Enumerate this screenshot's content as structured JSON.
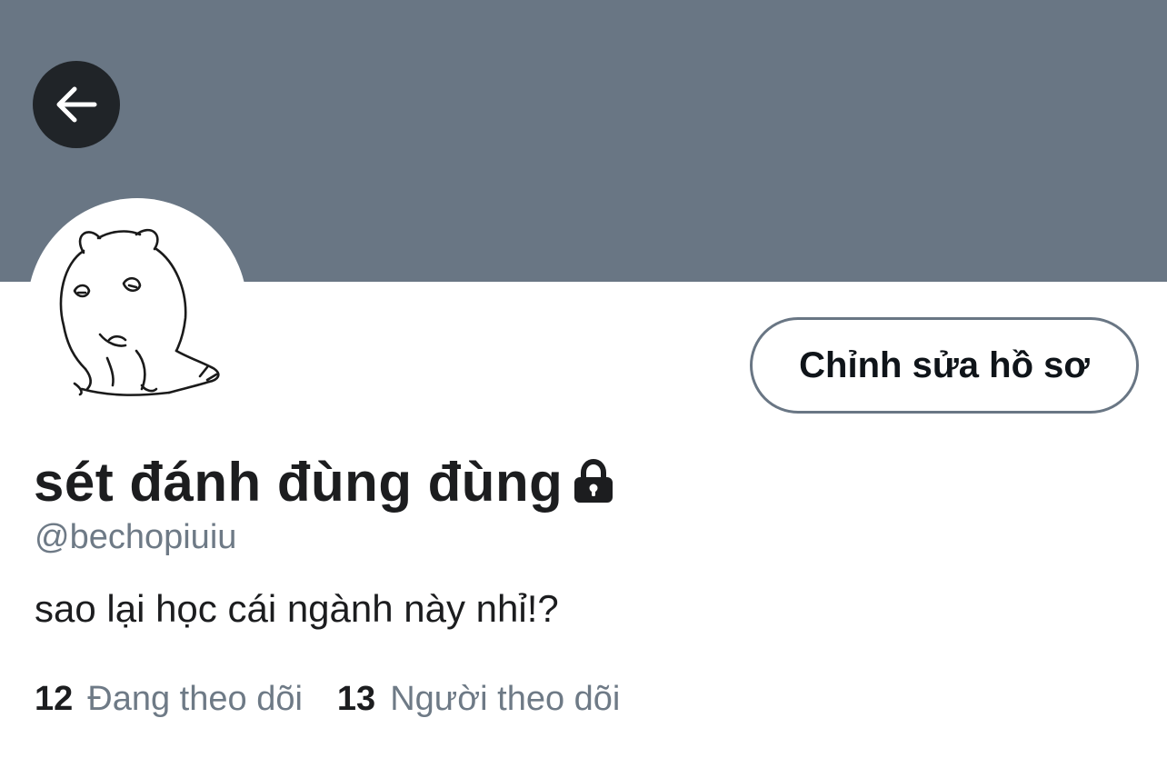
{
  "header": {
    "banner_color": "#697684",
    "back_icon": "arrow-left-icon"
  },
  "profile": {
    "avatar_icon": "hamster-sketch-avatar",
    "edit_button_label": "Chỉnh sửa hồ sơ",
    "display_name": "sét đánh đùng đùng",
    "protected_icon": "lock-icon",
    "handle": "@bechopiuiu",
    "bio": "sao lại học cái ngành này nhỉ!?"
  },
  "stats": {
    "following": {
      "count": "12",
      "label": "Đang theo dõi"
    },
    "followers": {
      "count": "13",
      "label": "Người theo dõi"
    }
  },
  "colors": {
    "text_primary": "#1c1d1f",
    "text_secondary": "#6e7a86",
    "button_border": "#697684"
  }
}
